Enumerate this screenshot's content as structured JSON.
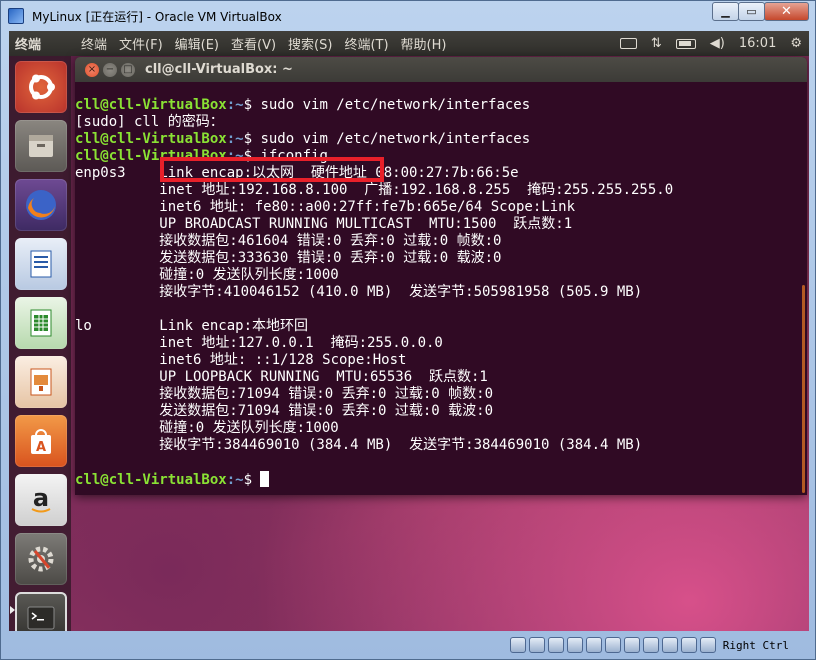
{
  "vbox": {
    "title": "MyLinux [正在运行] - Oracle VM VirtualBox",
    "host_key": "Right Ctrl",
    "status_icons": [
      "hard-disk-icon",
      "optical-drive-icon",
      "audio-icon",
      "network-icon",
      "usb-icon",
      "shared-folders-icon",
      "display-icon",
      "video-capture-icon",
      "virtualization-icon",
      "mouse-integration-icon",
      "host-key-icon"
    ]
  },
  "top_panel": {
    "app_title": "终端",
    "menu": [
      "终端",
      "文件(F)",
      "编辑(E)",
      "查看(V)",
      "搜索(S)",
      "终端(T)",
      "帮助(H)"
    ],
    "clock": "16:01"
  },
  "launcher": {
    "items": [
      "ubuntu-dash",
      "files",
      "firefox",
      "libreoffice-writer",
      "libreoffice-calc",
      "libreoffice-impress",
      "ubuntu-software",
      "amazon",
      "system-settings",
      "terminal"
    ]
  },
  "terminal": {
    "title": "cll@cll-VirtualBox: ~",
    "prompt_user": "cll@cll-VirtualBox",
    "prompt_path": ":~",
    "prompt_symbol": "$",
    "lines": [
      {
        "type": "cmd",
        "text": " sudo vim /etc/network/interfaces"
      },
      {
        "type": "out",
        "text": "[sudo] cll 的密码："
      },
      {
        "type": "cmd",
        "text": " sudo vim /etc/network/interfaces"
      },
      {
        "type": "cmd",
        "text": " ifconfig"
      },
      {
        "type": "out",
        "text": "enp0s3    Link encap:以太网  硬件地址 08:00:27:7b:66:5e"
      },
      {
        "type": "out",
        "text": "          inet 地址:192.168.8.100  广播:192.168.8.255  掩码:255.255.255.0"
      },
      {
        "type": "out",
        "text": "          inet6 地址: fe80::a00:27ff:fe7b:665e/64 Scope:Link"
      },
      {
        "type": "out",
        "text": "          UP BROADCAST RUNNING MULTICAST  MTU:1500  跃点数:1"
      },
      {
        "type": "out",
        "text": "          接收数据包:461604 错误:0 丢弃:0 过载:0 帧数:0"
      },
      {
        "type": "out",
        "text": "          发送数据包:333630 错误:0 丢弃:0 过载:0 载波:0"
      },
      {
        "type": "out",
        "text": "          碰撞:0 发送队列长度:1000"
      },
      {
        "type": "out",
        "text": "          接收字节:410046152 (410.0 MB)  发送字节:505981958 (505.9 MB)"
      },
      {
        "type": "out",
        "text": ""
      },
      {
        "type": "out",
        "text": "lo        Link encap:本地环回"
      },
      {
        "type": "out",
        "text": "          inet 地址:127.0.0.1  掩码:255.0.0.0"
      },
      {
        "type": "out",
        "text": "          inet6 地址: ::1/128 Scope:Host"
      },
      {
        "type": "out",
        "text": "          UP LOOPBACK RUNNING  MTU:65536  跃点数:1"
      },
      {
        "type": "out",
        "text": "          接收数据包:71094 错误:0 丢弃:0 过载:0 帧数:0"
      },
      {
        "type": "out",
        "text": "          发送数据包:71094 错误:0 丢弃:0 过载:0 载波:0"
      },
      {
        "type": "out",
        "text": "          碰撞:0 发送队列长度:1000"
      },
      {
        "type": "out",
        "text": "          接收字节:384469010 (384.4 MB)  发送字节:384469010 (384.4 MB)"
      },
      {
        "type": "out",
        "text": ""
      },
      {
        "type": "prompt",
        "text": " "
      }
    ]
  },
  "colors": {
    "terminal_bg": "#300a24",
    "prompt_green": "#8ae234",
    "prompt_blue": "#729fcf",
    "highlight_red": "#e8202a"
  }
}
